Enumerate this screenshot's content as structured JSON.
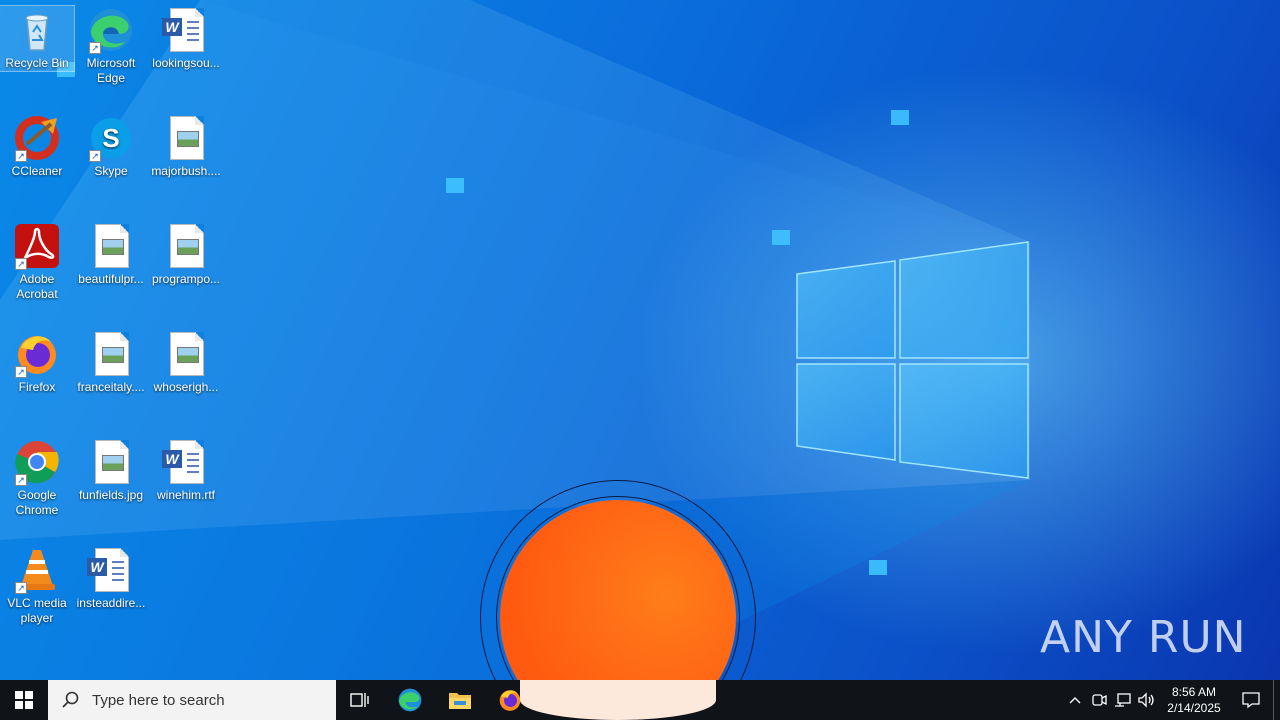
{
  "desktop": {
    "icons": [
      {
        "id": "recycle-bin",
        "label": "Recycle Bin",
        "icon": "recycle-bin-icon"
      },
      {
        "id": "edge",
        "label": "Microsoft Edge",
        "icon": "edge-icon"
      },
      {
        "id": "lookingsou",
        "label": "lookingsou...",
        "icon": "word-document-icon"
      },
      {
        "id": "ccleaner",
        "label": "CCleaner",
        "icon": "ccleaner-icon"
      },
      {
        "id": "skype",
        "label": "Skype",
        "icon": "skype-icon"
      },
      {
        "id": "majorbush",
        "label": "majorbush....",
        "icon": "image-file-icon"
      },
      {
        "id": "acrobat",
        "label": "Adobe Acrobat",
        "icon": "acrobat-icon"
      },
      {
        "id": "beautifulpr",
        "label": "beautifulpr...",
        "icon": "image-file-icon"
      },
      {
        "id": "programpo",
        "label": "programpo...",
        "icon": "image-file-icon"
      },
      {
        "id": "firefox",
        "label": "Firefox",
        "icon": "firefox-icon"
      },
      {
        "id": "franceitaly",
        "label": "franceitaly....",
        "icon": "image-file-icon"
      },
      {
        "id": "whoserigh",
        "label": "whoserigh...",
        "icon": "image-file-icon"
      },
      {
        "id": "chrome",
        "label": "Google Chrome",
        "icon": "chrome-icon"
      },
      {
        "id": "funfields",
        "label": "funfields.jpg",
        "icon": "image-file-icon"
      },
      {
        "id": "winehim",
        "label": "winehim.rtf",
        "icon": "word-document-icon"
      },
      {
        "id": "vlc",
        "label": "VLC media player",
        "icon": "vlc-icon"
      },
      {
        "id": "insteaddire",
        "label": "insteaddire...",
        "icon": "word-document-icon"
      }
    ],
    "watermark": "ANY RUN"
  },
  "taskbar": {
    "search_placeholder": "Type here to search",
    "pinned": [
      "task-view-icon",
      "edge-icon",
      "file-explorer-icon",
      "firefox-icon"
    ],
    "tray_icons": [
      "chevron-up-icon",
      "meet-now-icon",
      "network-icon",
      "volume-icon"
    ],
    "time": "8:56 AM",
    "date": "2/14/2025",
    "notifications_icon": "action-center-icon"
  },
  "colors": {
    "desktop_blue": "#0a6fdc",
    "taskbar": "#101317",
    "overlay_orange": "#ff5a10"
  }
}
